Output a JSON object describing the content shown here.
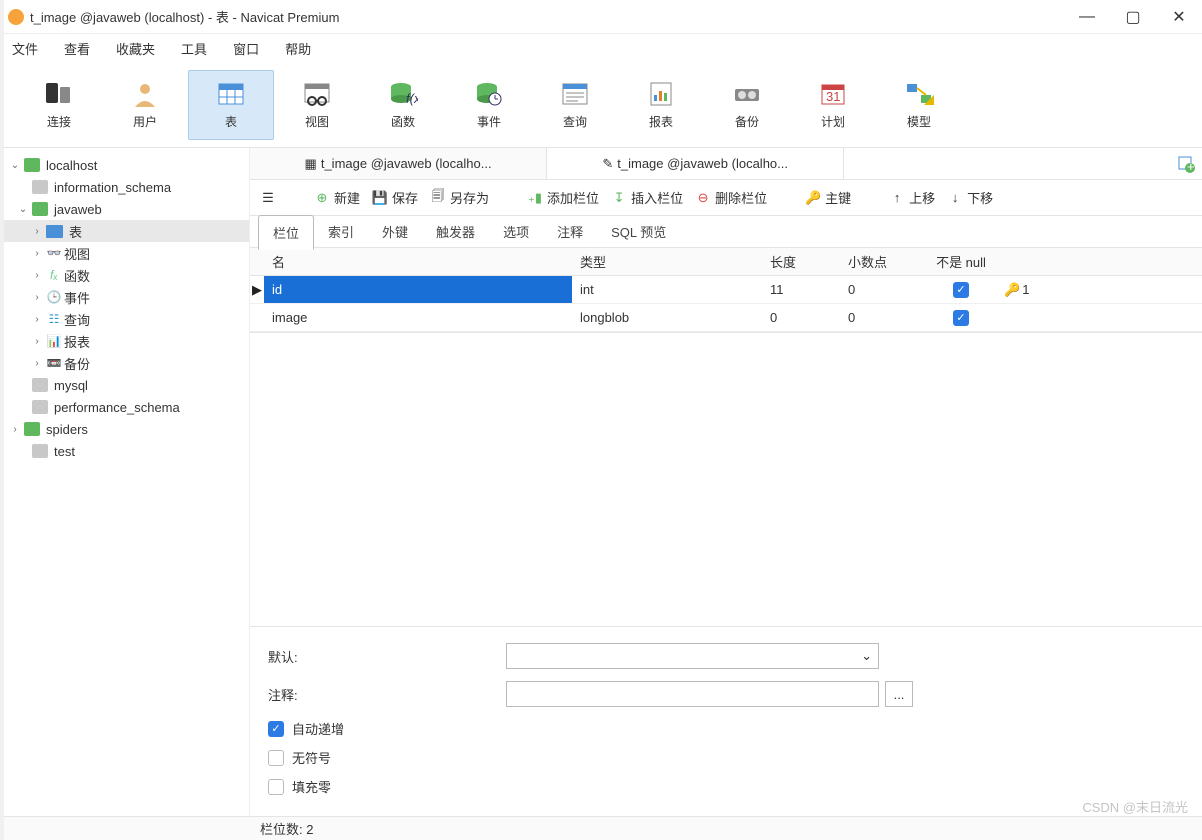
{
  "title": "t_image @javaweb (localhost) - 表 - Navicat Premium",
  "menu": {
    "file": "文件",
    "view": "查看",
    "fav": "收藏夹",
    "tools": "工具",
    "window": "窗口",
    "help": "帮助"
  },
  "toolbar": {
    "connect": "连接",
    "user": "用户",
    "table": "表",
    "views": "视图",
    "function": "函数",
    "event": "事件",
    "query": "查询",
    "report": "报表",
    "backup": "备份",
    "schedule": "计划",
    "model": "模型"
  },
  "tree": {
    "localhost": "localhost",
    "information_schema": "information_schema",
    "javaweb": "javaweb",
    "tables": "表",
    "views": "视图",
    "functions": "函数",
    "events": "事件",
    "queries": "查询",
    "reports": "报表",
    "backups": "备份",
    "mysql": "mysql",
    "performance_schema": "performance_schema",
    "spiders": "spiders",
    "test": "test"
  },
  "etabs": {
    "t1": "t_image @javaweb (localho...",
    "t2": "t_image @javaweb (localho..."
  },
  "actions": {
    "new": "新建",
    "save": "保存",
    "saveas": "另存为",
    "addcol": "添加栏位",
    "inscol": "插入栏位",
    "delcol": "删除栏位",
    "pkey": "主键",
    "up": "上移",
    "down": "下移"
  },
  "subtabs": {
    "col": "栏位",
    "idx": "索引",
    "fk": "外键",
    "trig": "触发器",
    "opt": "选项",
    "cmt": "注释",
    "sql": "SQL 预览"
  },
  "cols": {
    "name": "名",
    "type": "类型",
    "len": "长度",
    "dec": "小数点",
    "nn": "不是 null"
  },
  "rows": [
    {
      "name": "id",
      "type": "int",
      "len": "11",
      "dec": "0",
      "nn": true,
      "key": "1"
    },
    {
      "name": "image",
      "type": "longblob",
      "len": "0",
      "dec": "0",
      "nn": true,
      "key": ""
    }
  ],
  "props": {
    "defaultLabel": "默认:",
    "commentLabel": "注释:",
    "autoinc": "自动递增",
    "unsigned": "无符号",
    "zerofill": "填充零",
    "dots": "..."
  },
  "status": "栏位数: 2",
  "watermark": "CSDN @末日流光"
}
